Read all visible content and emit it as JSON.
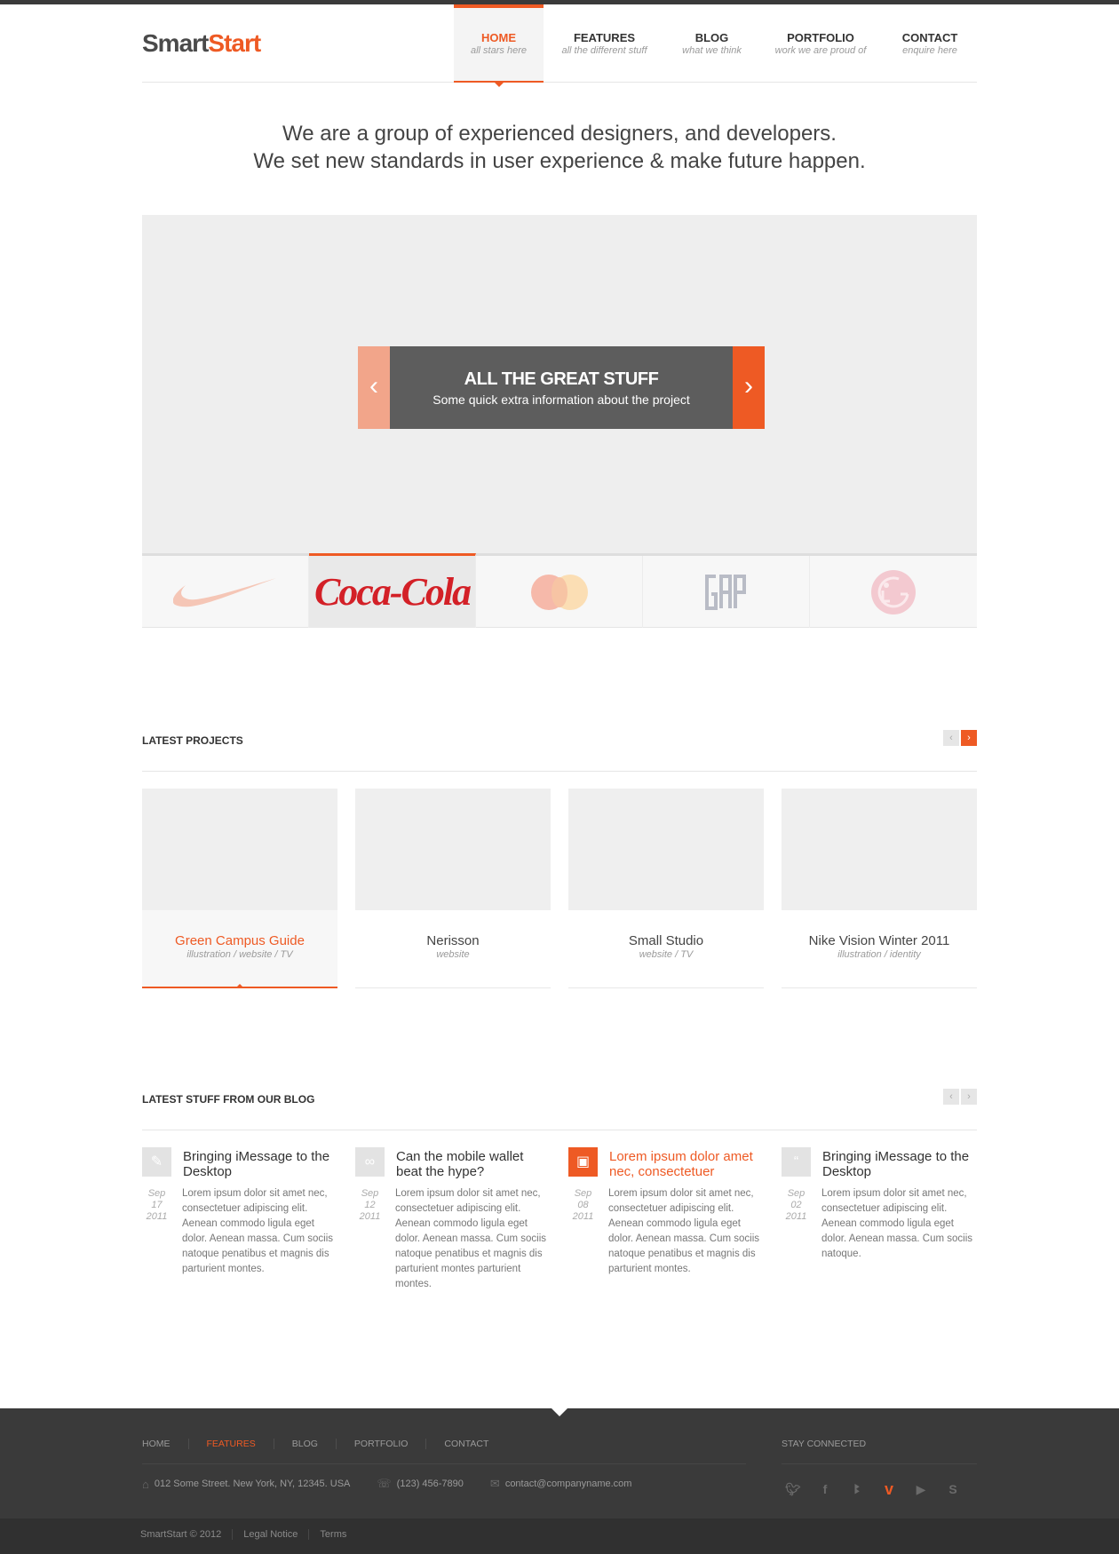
{
  "logo": {
    "part1": "Smart",
    "part2": "Start"
  },
  "nav": [
    {
      "title": "HOME",
      "sub": "all stars here"
    },
    {
      "title": "FEATURES",
      "sub": "all the different stuff"
    },
    {
      "title": "BLOG",
      "sub": "what we think"
    },
    {
      "title": "PORTFOLIO",
      "sub": "work we are proud of"
    },
    {
      "title": "CONTACT",
      "sub": "enquire here"
    }
  ],
  "hero": {
    "line1": "We are a group of experienced designers, and developers.",
    "line2": "We set new standards in user experience & make future happen."
  },
  "slider": {
    "caption_title": "ALL THE GREAT STUFF",
    "caption_sub": "Some quick extra information about the project",
    "prev_glyph": "‹",
    "next_glyph": "›"
  },
  "brands": [
    {
      "name": "nike-logo"
    },
    {
      "name": "coca-cola-logo",
      "label": "Coca-Cola"
    },
    {
      "name": "mastercard-logo"
    },
    {
      "name": "gap-logo"
    },
    {
      "name": "lg-logo"
    }
  ],
  "projects": {
    "heading": "LATEST PROJECTS",
    "items": [
      {
        "title": "Green Campus Guide",
        "tags": "illustration / website / TV"
      },
      {
        "title": "Nerisson",
        "tags": "website"
      },
      {
        "title": "Small Studio",
        "tags": "website / TV"
      },
      {
        "title": "Nike Vision Winter 2011",
        "tags": "illustration / identity"
      }
    ]
  },
  "blog": {
    "heading": "LATEST STUFF FROM OUR BLOG",
    "posts": [
      {
        "icon": "pencil-icon",
        "title": "Bringing iMessage to the Desktop",
        "date_md": "Sep 17",
        "date_y": "2011",
        "body": "Lorem ipsum dolor sit amet nec, consectetuer adipiscing elit. Aenean commodo ligula eget dolor. Aenean massa. Cum sociis natoque penatibus et magnis dis parturient montes."
      },
      {
        "icon": "link-icon",
        "title": "Can the mobile wallet beat the hype?",
        "date_md": "Sep 12",
        "date_y": "2011",
        "body": "Lorem ipsum dolor sit amet nec, consectetuer adipiscing elit. Aenean commodo ligula eget dolor. Aenean massa. Cum sociis natoque penatibus et magnis dis parturient montes parturient montes."
      },
      {
        "icon": "image-icon",
        "title": "Lorem ipsum dolor amet nec, consectetuer",
        "date_md": "Sep 08",
        "date_y": "2011",
        "body": "Lorem ipsum dolor sit amet nec, consectetuer adipiscing elit. Aenean commodo ligula eget dolor. Aenean massa. Cum sociis natoque penatibus et magnis dis parturient montes."
      },
      {
        "icon": "quote-icon",
        "title": "Bringing iMessage to the Desktop",
        "date_md": "Sep 02",
        "date_y": "2011",
        "body": "Lorem ipsum dolor sit amet nec, consectetuer adipiscing elit. Aenean commodo ligula eget dolor. Aenean massa. Cum sociis natoque."
      }
    ]
  },
  "footer": {
    "nav": [
      "HOME",
      "FEATURES",
      "BLOG",
      "PORTFOLIO",
      "CONTACT"
    ],
    "address": "012 Some Street. New York, NY, 12345. USA",
    "phone": "(123) 456-7890",
    "email": "contact@companyname.com",
    "stay_connected": "STAY CONNECTED",
    "social": [
      "twitter-icon",
      "facebook-icon",
      "myspace-icon",
      "vimeo-icon",
      "youtube-icon",
      "skype-icon"
    ],
    "copyright": "SmartStart © 2012",
    "legal": "Legal Notice",
    "terms": "Terms"
  },
  "colors": {
    "accent": "#ee5a24",
    "dark": "#3a3a3a",
    "placeholder": "#eeeeee"
  }
}
